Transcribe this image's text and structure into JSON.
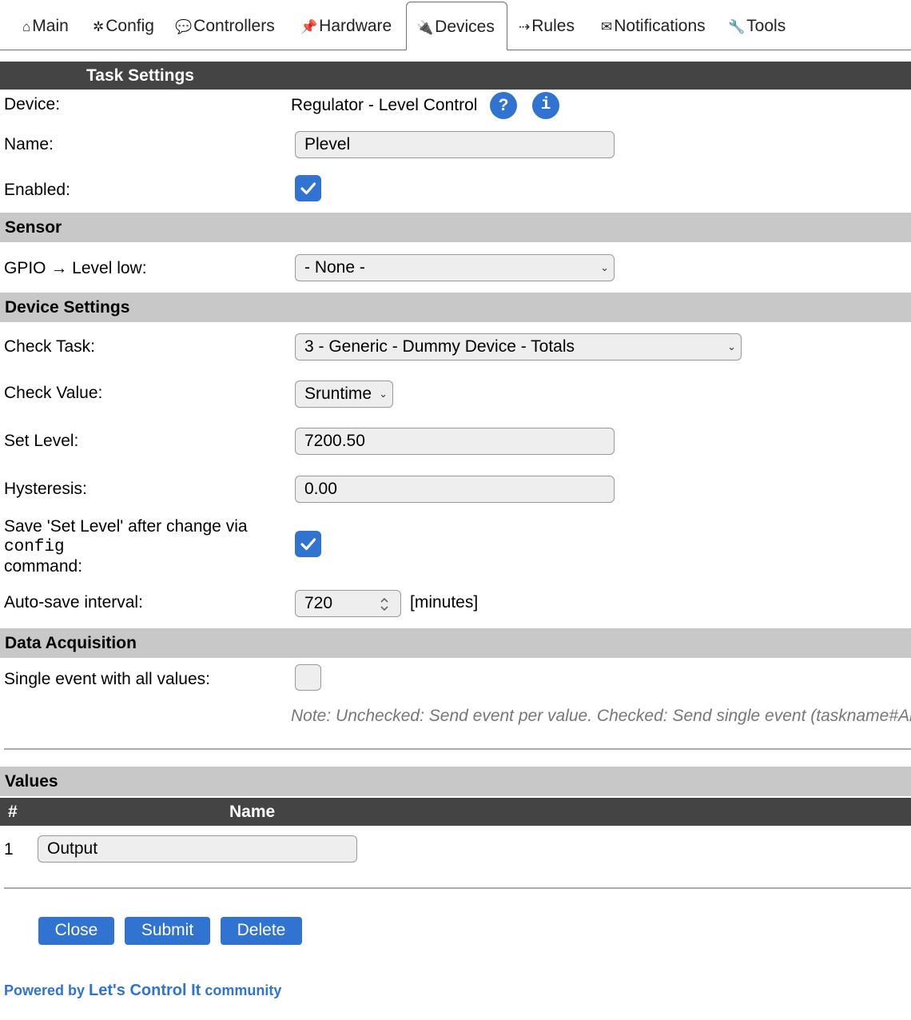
{
  "tabs": [
    {
      "icon": "⌂",
      "label": "Main"
    },
    {
      "icon": "✲",
      "label": "Config"
    },
    {
      "icon": "💬",
      "label": "Controllers"
    },
    {
      "icon": "📌",
      "label": "Hardware"
    },
    {
      "icon": "🔌",
      "label": "Devices"
    },
    {
      "icon": "⇢",
      "label": "Rules"
    },
    {
      "icon": "✉",
      "label": "Notifications"
    },
    {
      "icon": "🔧",
      "label": "Tools"
    }
  ],
  "task_settings": {
    "title": "Task Settings",
    "device_label": "Device:",
    "device_value": "Regulator - Level Control",
    "help_q": "?",
    "help_i": "i",
    "name_label": "Name:",
    "name_value": "Plevel",
    "enabled_label": "Enabled:",
    "enabled": true
  },
  "sensor": {
    "title": "Sensor",
    "gpio_label": "GPIO → Level low:",
    "gpio_value": "- None -"
  },
  "device_settings": {
    "title": "Device Settings",
    "check_task_label": "Check Task:",
    "check_task_value": "3 - Generic - Dummy Device - Totals",
    "check_value_label": "Check Value:",
    "check_value_value": "Sruntime",
    "set_level_label": "Set Level:",
    "set_level_value": "7200.50",
    "hysteresis_label": "Hysteresis:",
    "hysteresis_value": "0.00",
    "save_label_1": "Save 'Set Level' after change via",
    "save_label_code": "config",
    "save_label_2": "command:",
    "save_checked": true,
    "autosave_label": "Auto-save interval:",
    "autosave_value": "720",
    "autosave_unit": "[minutes]"
  },
  "data_acquisition": {
    "title": "Data Acquisition",
    "single_event_label": "Single event with all values:",
    "single_event_checked": false,
    "note": "Note: Unchecked: Send event per value. Checked: Send single event (taskname#All) containing all values."
  },
  "values": {
    "title": "Values",
    "col_num": "#",
    "col_name": "Name",
    "rows": [
      {
        "num": "1",
        "name": "Output"
      }
    ]
  },
  "buttons": {
    "close": "Close",
    "submit": "Submit",
    "delete": "Delete"
  },
  "footer": {
    "prefix": "Powered by ",
    "brand": "Let's Control It",
    "suffix": " community"
  },
  "colors": {
    "accent": "#3073d1",
    "header_bar": "#444444",
    "section_bar": "#c8c8c8"
  }
}
